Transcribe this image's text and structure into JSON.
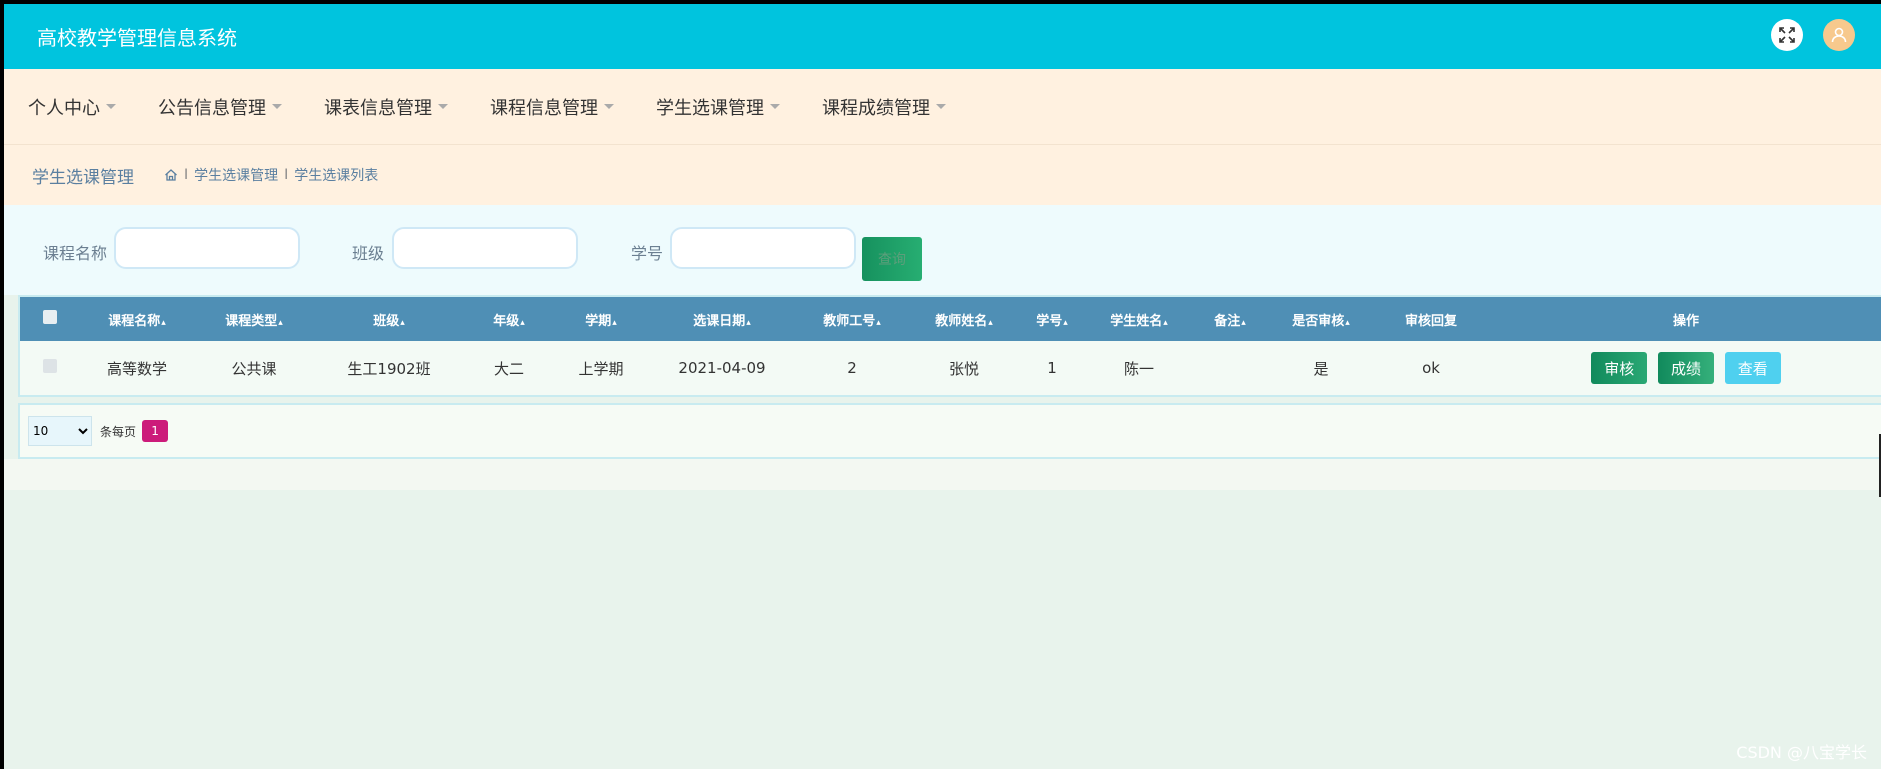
{
  "app": {
    "title": "高校教学管理信息系统"
  },
  "topbar": {
    "fullscreen_icon": "fullscreen-icon",
    "user_icon": "user-icon",
    "user_color": "#f7c98d"
  },
  "nav": {
    "items": [
      {
        "label": "个人中心"
      },
      {
        "label": "公告信息管理"
      },
      {
        "label": "课表信息管理"
      },
      {
        "label": "课程信息管理"
      },
      {
        "label": "学生选课管理"
      },
      {
        "label": "课程成绩管理"
      }
    ]
  },
  "breadcrumb": {
    "title": "学生选课管理",
    "separator": "I",
    "trail": [
      "学生选课管理",
      "学生选课列表"
    ]
  },
  "search": {
    "fields": [
      {
        "label": "课程名称",
        "value": ""
      },
      {
        "label": "班级",
        "value": ""
      },
      {
        "label": "学号",
        "value": ""
      }
    ],
    "button_label": "查询"
  },
  "table": {
    "headers": [
      "课程名称",
      "课程类型",
      "班级",
      "年级",
      "学期",
      "选课日期",
      "教师工号",
      "教师姓名",
      "学号",
      "学生姓名",
      "备注",
      "是否审核",
      "审核回复",
      "操作"
    ],
    "rows": [
      [
        "高等数学",
        "公共课",
        "生工1902班",
        "大二",
        "上学期",
        "2021-04-09",
        "2",
        "张悦",
        "1",
        "陈一",
        "",
        "是",
        "ok"
      ]
    ],
    "actions": [
      "审核",
      "成绩",
      "查看"
    ]
  },
  "pager": {
    "page_size": "10",
    "per_page_label": "条每页",
    "current_page": "1"
  },
  "colors": {
    "header_bg": "#00c4de",
    "nav_bg": "#fff1e0",
    "table_header_bg": "#4f8fb5",
    "page_active": "#cc1b7a"
  },
  "watermark": "CSDN @八宝学长"
}
